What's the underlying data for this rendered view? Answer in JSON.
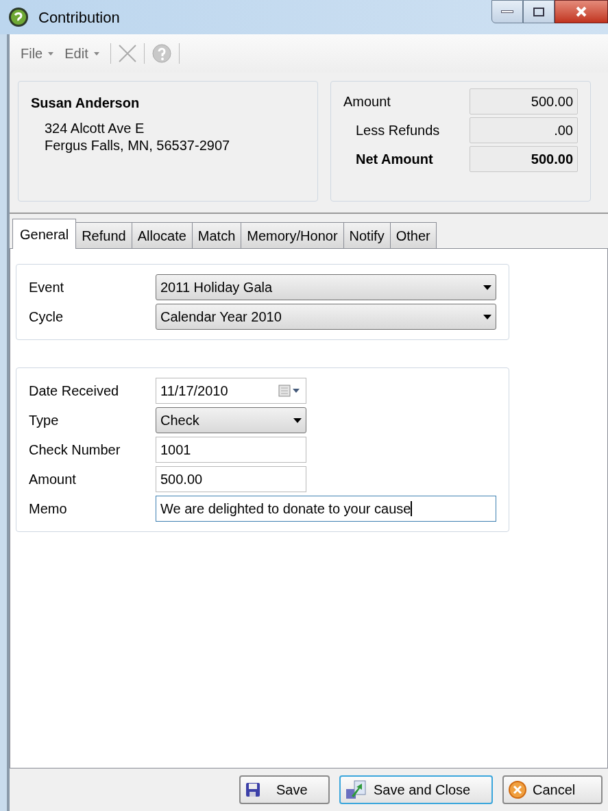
{
  "window": {
    "title": "Contribution"
  },
  "toolbar": {
    "menus": [
      {
        "label": "File"
      },
      {
        "label": "Edit"
      }
    ]
  },
  "donor": {
    "name": "Susan Anderson",
    "address_lines": [
      "324 Alcott Ave E",
      "Fergus Falls, MN, 56537-2907"
    ]
  },
  "totals": [
    {
      "label": "Amount",
      "value": "500.00",
      "bold": false
    },
    {
      "label": "Less Refunds",
      "value": ".00",
      "bold": false
    },
    {
      "label": "Net Amount",
      "value": "500.00",
      "bold": true
    }
  ],
  "tabs": [
    {
      "label": "General",
      "selected": true
    },
    {
      "label": "Refund",
      "selected": false
    },
    {
      "label": "Allocate",
      "selected": false
    },
    {
      "label": "Match",
      "selected": false
    },
    {
      "label": "Memory/Honor",
      "selected": false
    },
    {
      "label": "Notify",
      "selected": false
    },
    {
      "label": "Other",
      "selected": false
    }
  ],
  "groups": [
    {
      "fields": [
        {
          "kind": "combo",
          "label": "Event",
          "value": "2011 Holiday Gala",
          "focused": false
        },
        {
          "kind": "combo",
          "label": "Cycle",
          "value": "Calendar Year 2010",
          "focused": false
        }
      ]
    },
    {
      "fields": [
        {
          "kind": "date",
          "label": "Date Received",
          "value": "11/17/2010",
          "focused": false
        },
        {
          "kind": "small-combo",
          "label": "Type",
          "value": "Check",
          "focused": false
        },
        {
          "kind": "short-text",
          "label": "Check Number",
          "value": "1001",
          "focused": false
        },
        {
          "kind": "short-text",
          "label": "Amount",
          "value": "500.00",
          "focused": false
        },
        {
          "kind": "text",
          "label": "Memo",
          "value": "We are delighted to donate to your cause",
          "focused": true
        }
      ]
    }
  ],
  "buttons": [
    {
      "kind": "save",
      "label": "Save",
      "default": false
    },
    {
      "kind": "save-close",
      "label": "Save and Close",
      "default": true
    },
    {
      "kind": "cancel",
      "label": "Cancel",
      "default": false
    }
  ]
}
